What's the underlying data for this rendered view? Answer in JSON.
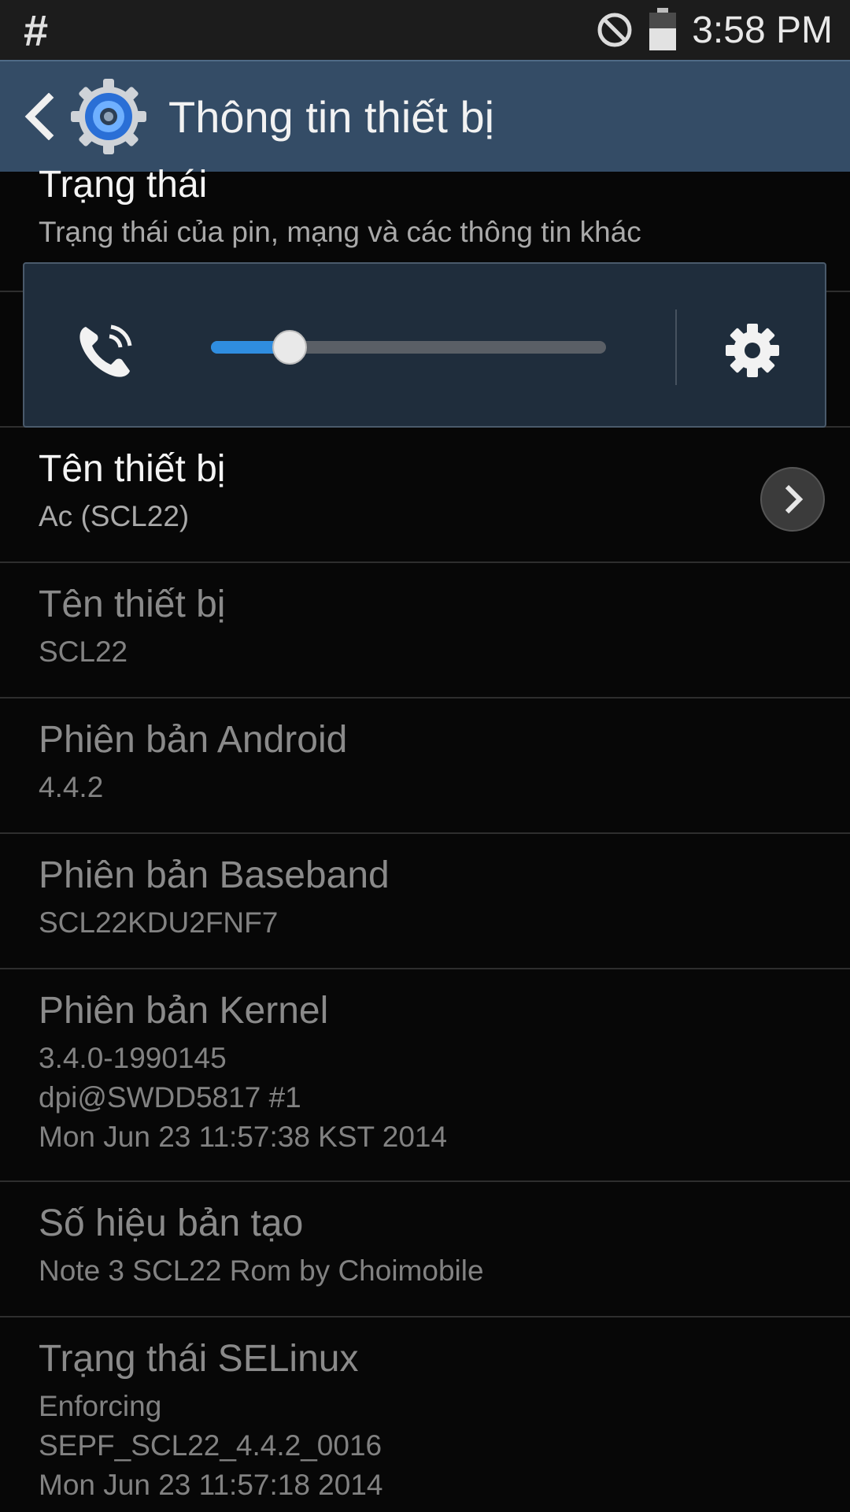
{
  "status_bar": {
    "left_symbol": "#",
    "time": "3:58 PM",
    "icons": [
      "do-not-disturb-icon",
      "battery-icon"
    ]
  },
  "action_bar": {
    "title": "Thông tin thiết bị",
    "back_icon": "back-icon",
    "logo_icon": "settings-gear-icon"
  },
  "volume_panel": {
    "stream_icon": "in-call-volume-icon",
    "level_fraction": 0.2,
    "settings_icon": "gear-icon",
    "accent": "#2f8de0"
  },
  "rows": [
    {
      "title": "Trạng thái",
      "sub": [
        "Trạng thái của pin, mạng và các thông tin khác"
      ],
      "enabled": true
    },
    {
      "title": "Tên thiết bị",
      "sub": [
        "Ac (SCL22)"
      ],
      "enabled": true,
      "has_chevron": true
    },
    {
      "title": "Tên thiết bị",
      "sub": [
        "SCL22"
      ],
      "enabled": false
    },
    {
      "title": "Phiên bản Android",
      "sub": [
        "4.4.2"
      ],
      "enabled": false
    },
    {
      "title": "Phiên bản Baseband",
      "sub": [
        "SCL22KDU2FNF7"
      ],
      "enabled": false
    },
    {
      "title": "Phiên bản Kernel",
      "sub": [
        "3.4.0-1990145",
        "dpi@SWDD5817 #1",
        "Mon Jun 23 11:57:38 KST 2014"
      ],
      "enabled": false
    },
    {
      "title": "Số hiệu bản tạo",
      "sub": [
        "Note 3 SCL22 Rom by Choimobile"
      ],
      "enabled": false
    },
    {
      "title": "Trạng thái SELinux",
      "sub": [
        "Enforcing",
        "SEPF_SCL22_4.4.2_0016",
        "Mon Jun 23 11:57:18 2014"
      ],
      "enabled": false
    }
  ]
}
